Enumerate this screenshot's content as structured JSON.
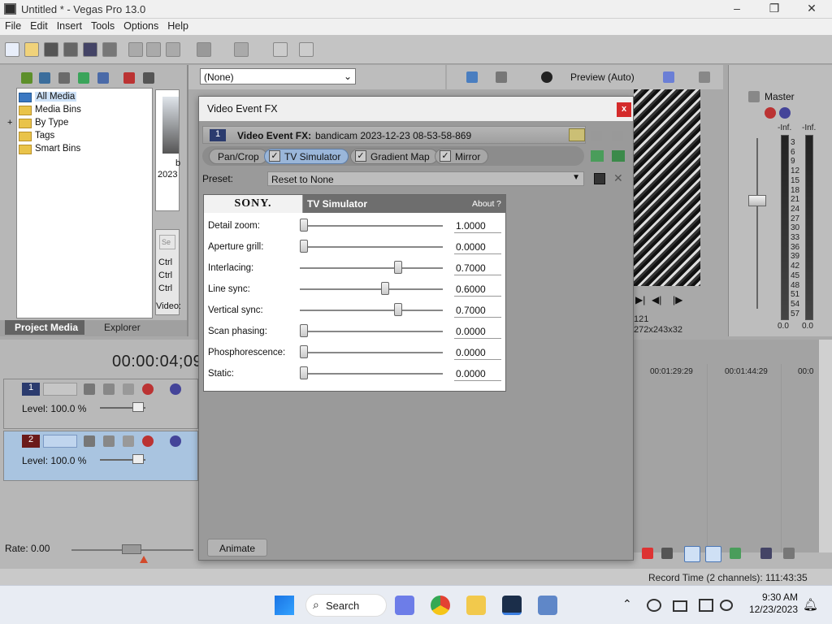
{
  "window": {
    "title": "Untitled * - Vegas Pro 13.0",
    "minimize": "–",
    "restore": "❐",
    "close": "✕"
  },
  "menu": [
    "File",
    "Edit",
    "Insert",
    "Tools",
    "Options",
    "Help"
  ],
  "explorer_tree": [
    "All Media",
    "Media Bins",
    "By Type",
    "Tags",
    "Smart Bins"
  ],
  "tree_expander": "+",
  "thumb_labels": {
    "year": "2023",
    "b": "b",
    "ctrl1": "Ctrl",
    "ctrl2": "Ctrl",
    "ctrl3": "Ctrl",
    "video": "Video:",
    "se": "Se"
  },
  "left_tabs": {
    "project_media": "Project Media",
    "explorer": "Explorer"
  },
  "top_preset": "(None)",
  "preview": {
    "mode": "Preview (Auto)",
    "frame": "121",
    "resolution": "272x243x32"
  },
  "master": {
    "label": "Master",
    "left_inf": "-Inf.",
    "right_inf": "-Inf.",
    "scale": [
      "3",
      "6",
      "9",
      "12",
      "15",
      "18",
      "21",
      "24",
      "27",
      "30",
      "33",
      "36",
      "39",
      "42",
      "45",
      "48",
      "51",
      "54",
      "57"
    ],
    "left_bottom": "0.0",
    "right_bottom": "0.0"
  },
  "timeline": {
    "timecode": "00:00:04;09",
    "ruler": [
      "00:01:29:29",
      "00:01:44:29",
      "00:0"
    ],
    "tracks": [
      {
        "number": "1",
        "level": "Level: 100.0 %"
      },
      {
        "number": "2",
        "level": "Level: 100.0 %"
      }
    ],
    "rate": "Rate: 0.00"
  },
  "status": {
    "record_time": "Record Time (2 channels): 111:43:35"
  },
  "fx": {
    "title": "Video Event FX",
    "close": "x",
    "header_num": "1",
    "header_label": "Video Event FX:",
    "header_value": "bandicam 2023-12-23 08-53-58-869",
    "chain": [
      {
        "name": "Pan/Crop",
        "checked": false,
        "active": false
      },
      {
        "name": "TV Simulator",
        "checked": true,
        "active": true
      },
      {
        "name": "Gradient Map",
        "checked": true,
        "active": false
      },
      {
        "name": "Mirror",
        "checked": true,
        "active": false
      }
    ],
    "check": "✓",
    "preset_label": "Preset:",
    "preset_value": "Reset to None",
    "panel": {
      "brand": "SONY.",
      "name": "TV Simulator",
      "about": "About",
      "help": "?",
      "params": [
        {
          "label": "Detail zoom:",
          "value": "1.0000",
          "pos": 0.0
        },
        {
          "label": "Aperture grill:",
          "value": "0.0000",
          "pos": 0.0
        },
        {
          "label": "Interlacing:",
          "value": "0.7000",
          "pos": 0.7
        },
        {
          "label": "Line sync:",
          "value": "0.6000",
          "pos": 0.6
        },
        {
          "label": "Vertical sync:",
          "value": "0.7000",
          "pos": 0.7
        },
        {
          "label": "Scan phasing:",
          "value": "0.0000",
          "pos": 0.0
        },
        {
          "label": "Phosphorescence:",
          "value": "0.0000",
          "pos": 0.0
        },
        {
          "label": "Static:",
          "value": "0.0000",
          "pos": 0.0
        }
      ]
    },
    "animate": "Animate"
  },
  "taskbar": {
    "search": "Search",
    "time": "9:30 AM",
    "date": "12/23/2023"
  }
}
